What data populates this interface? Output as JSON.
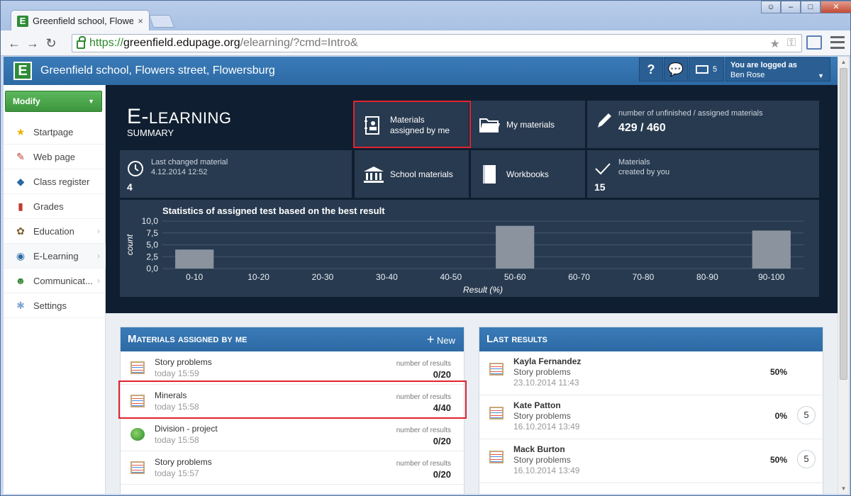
{
  "browser": {
    "tab_title": "Greenfield school, Flowers",
    "tab_close": "×",
    "url_scheme": "https://",
    "url_host": "greenfield.edupage.org",
    "url_path": "/elearning/?cmd=Intro&",
    "win_min": "–",
    "win_max": "□",
    "win_close": "✕"
  },
  "header": {
    "logo": "E",
    "school_name": "Greenfield school, Flowers street, Flowersburg",
    "help": "?",
    "messages_count": "5",
    "logged_label": "You are logged as",
    "user_name": "Ben Rose"
  },
  "sidebar": {
    "modify_label": "Modify",
    "items": [
      {
        "label": "Startpage",
        "icon": "★"
      },
      {
        "label": "Web page",
        "icon": "✎"
      },
      {
        "label": "Class register",
        "icon": "◆"
      },
      {
        "label": "Grades",
        "icon": "▮"
      },
      {
        "label": "Education",
        "icon": "✿"
      },
      {
        "label": "E-Learning",
        "icon": "◉"
      },
      {
        "label": "Communicat...",
        "icon": "☻"
      },
      {
        "label": "Settings",
        "icon": "✱"
      }
    ]
  },
  "summary": {
    "title_e": "E-",
    "title_rest": "LEARNING",
    "subtitle": "SUMMARY",
    "materials_assigned": "Materials\nassigned by me",
    "my_materials": "My materials",
    "unfinished_label": "number of unfinished / assigned materials",
    "unfinished_value": "429 / 460",
    "last_changed_label": "Last changed material",
    "last_changed_date": "4.12.2014 12:52",
    "last_changed_value": "4",
    "school_materials": "School materials",
    "workbooks": "Workbooks",
    "created_label_1": "Materials",
    "created_label_2": "created by you",
    "created_value": "15"
  },
  "chart_data": {
    "type": "bar",
    "title": "Statistics of assigned test based on the best result",
    "xlabel": "Result (%)",
    "ylabel": "count",
    "categories": [
      "0-10",
      "10-20",
      "20-30",
      "30-40",
      "40-50",
      "50-60",
      "60-70",
      "70-80",
      "80-90",
      "90-100"
    ],
    "values": [
      4,
      0,
      0,
      0,
      0,
      9,
      0,
      0,
      0,
      8
    ],
    "yticks": [
      "10,0",
      "7,5",
      "5,0",
      "2,5",
      "0,0"
    ],
    "ylim": [
      0,
      10
    ],
    "grid": true,
    "bar_color": "#8a939e"
  },
  "assigned_panel": {
    "title": "Materials assigned by me",
    "new_label": "New",
    "rows": [
      {
        "name": "Story problems",
        "date": "today 15:59",
        "label": "number of results",
        "value": "0/20",
        "icon": "abacus"
      },
      {
        "name": "Minerals",
        "date": "today 15:58",
        "label": "number of results",
        "value": "4/40",
        "icon": "abacus"
      },
      {
        "name": "Division - project",
        "date": "today 15:58",
        "label": "number of results",
        "value": "0/20",
        "icon": "globe"
      },
      {
        "name": "Story problems",
        "date": "today 15:57",
        "label": "number of results",
        "value": "0/20",
        "icon": "abacus"
      }
    ]
  },
  "results_panel": {
    "title": "Last results",
    "rows": [
      {
        "name": "Kayla Fernandez",
        "material": "Story problems",
        "date": "23.10.2014 11:43",
        "percent": "50%",
        "count": ""
      },
      {
        "name": "Kate Patton",
        "material": "Story problems",
        "date": "16.10.2014 13:49",
        "percent": "0%",
        "count": "5"
      },
      {
        "name": "Mack Burton",
        "material": "Story problems",
        "date": "16.10.2014 13:49",
        "percent": "50%",
        "count": "5"
      }
    ]
  },
  "colors": {
    "header_blue": "#2d6aa4",
    "dark_bg": "#0f1e30",
    "tile": "#283a4f",
    "highlight_red": "#e0232f",
    "modify_green": "#3d963d"
  }
}
